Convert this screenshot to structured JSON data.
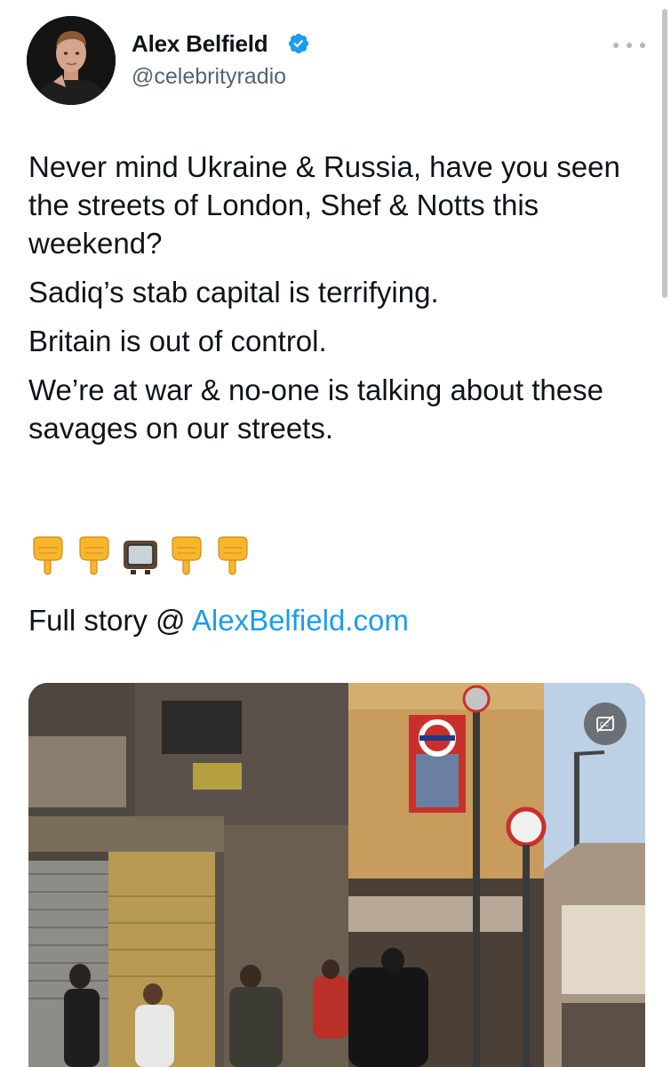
{
  "tweet": {
    "author": {
      "name": "Alex Belfield",
      "handle": "@celebrityradio",
      "verified": true
    },
    "paragraphs": [
      "Never mind Ukraine & Russia, have you seen the streets of London, Shef & Notts this weekend?",
      "Sadiq’s stab capital is terrifying.",
      "Britain is out of control.",
      "We’re at war & no-one is talking about these savages on our streets."
    ],
    "emojis": [
      "backhand-index-pointing-down",
      "backhand-index-pointing-down",
      "television",
      "backhand-index-pointing-down",
      "backhand-index-pointing-down"
    ],
    "full_story_prefix": "Full story @ ",
    "full_story_link": "AlexBelfield.com"
  },
  "colors": {
    "link": "#1d9bf0",
    "handle": "#536471",
    "verified": "#1d9bf0"
  }
}
